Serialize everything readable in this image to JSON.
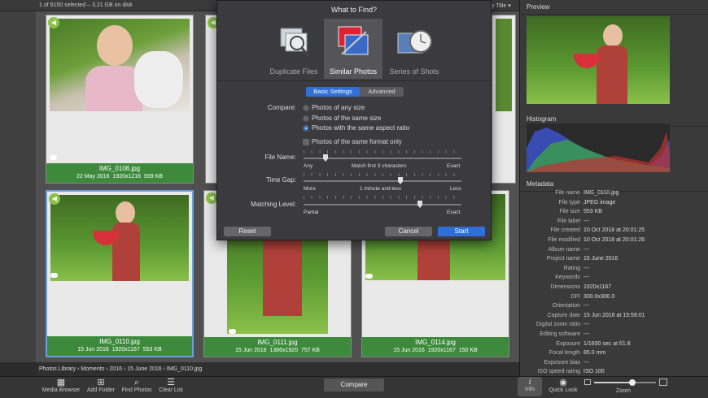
{
  "topbar": {
    "selection": "1 of 6150 selected – 3,21 GB on disk",
    "sort": "y Title ▾"
  },
  "cards": [
    {
      "name": "IMG_0106.jpg",
      "date": "22 May 2016",
      "dims": "1920x1216",
      "size": "559 KB"
    },
    {
      "name": "IMG_0110.jpg",
      "date": "15 Jun 2016",
      "dims": "1920x1167",
      "size": "553 KB"
    },
    {
      "name": "IMG_0111.jpg",
      "date": "15 Jun 2016",
      "dims": "1386x1920",
      "size": "757 KB"
    },
    {
      "name": "IMG_0114.jpg",
      "date": "15 Jun 2016",
      "dims": "1920x1167",
      "size": "150 KB"
    }
  ],
  "dialog": {
    "title": "What to Find?",
    "tabs": [
      "Duplicate Files",
      "Similar Photos",
      "Series of Shots"
    ],
    "seg": [
      "Basic Settings",
      "Advanced"
    ],
    "compare_label": "Compare:",
    "options": [
      "Photos of any size",
      "Photos of the same size",
      "Photos with the same aspect ratio"
    ],
    "format_only": "Photos of the same format only",
    "filename_label": "File Name:",
    "filename_left": "Any",
    "filename_mid": "Match first 3 characters",
    "filename_right": "Exact",
    "timegap_label": "Time Gap:",
    "timegap_left": "More",
    "timegap_mid": "1 minute and less",
    "timegap_right": "Less",
    "matching_label": "Matching Level:",
    "matching_left": "Partial",
    "matching_right": "Exact",
    "reset": "Reset",
    "cancel": "Cancel",
    "start": "Start"
  },
  "right": {
    "preview": "Preview",
    "histogram": "Histogram",
    "metadata": "Metadata",
    "meta": [
      [
        "File name",
        "IMG_0110.jpg"
      ],
      [
        "File type",
        "JPEG image"
      ],
      [
        "File size",
        "553 KB"
      ],
      [
        "File label",
        "---"
      ],
      [
        "File created",
        "10 Oct 2018 at 20:01:25"
      ],
      [
        "File modified",
        "10 Oct 2018 at 20:01:26"
      ],
      [
        "Album name",
        "---"
      ],
      [
        "Project name",
        "15 June 2016"
      ],
      [
        "Rating",
        "---"
      ],
      [
        "Keywords",
        "---"
      ],
      [
        "Dimensions",
        "1920x1167"
      ],
      [
        "DPI",
        "300.0x300.0"
      ],
      [
        "Orientation",
        "---"
      ],
      [
        "Capture date",
        "15 Jun 2016 at 15:59:01"
      ],
      [
        "Digital zoom ratio",
        "---"
      ],
      [
        "Editing software",
        "---"
      ],
      [
        "Exposure",
        "1/1600 sec at f/1.8"
      ],
      [
        "Focal length",
        "85.0 mm"
      ],
      [
        "Exposure bias",
        "---"
      ],
      [
        "ISO speed rating",
        "ISO 100"
      ]
    ]
  },
  "path": [
    "Photos Library",
    "Moments",
    "2016",
    "15 June 2016",
    "IMG_0110.jpg"
  ],
  "toolbar": {
    "media": "Media Browser",
    "add": "Add Folder",
    "find": "Find Photos",
    "clear": "Clear List",
    "compare": "Compare",
    "info": "Info",
    "quicklook": "Quick Look",
    "zoom": "Zoom"
  },
  "zoom_level": 0.62
}
